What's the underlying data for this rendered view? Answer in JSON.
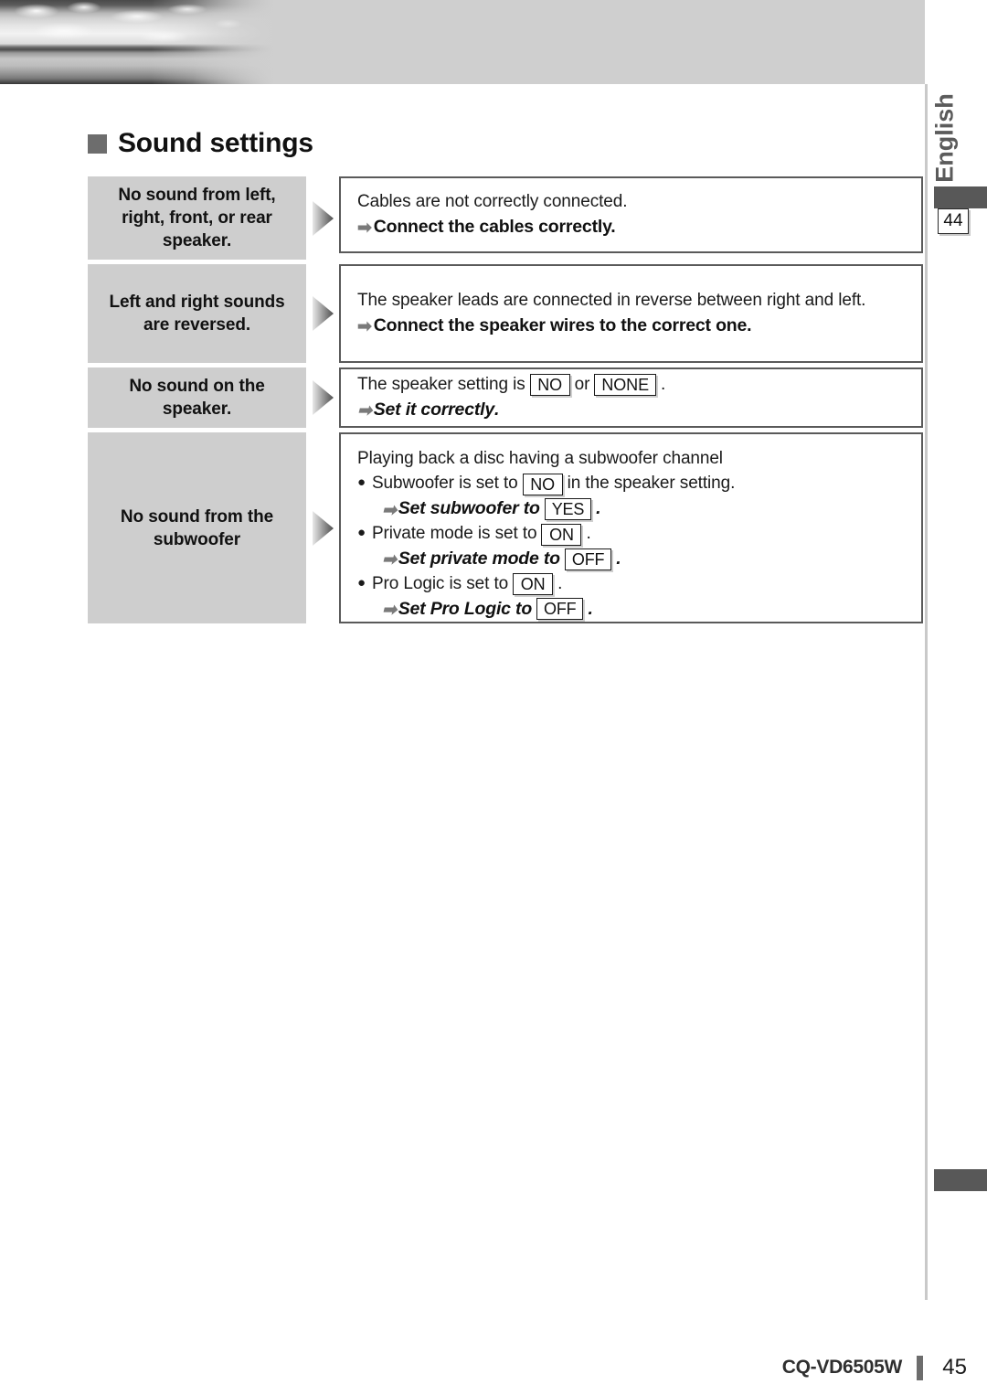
{
  "document": {
    "language_tab": "English",
    "page_reference_badge": "44",
    "section_heading": "Sound settings",
    "footer": {
      "model": "CQ-VD6505W",
      "page_number": "45"
    },
    "colors": {
      "symptom_cell_bg": "#cecece",
      "banner_bg": "#cfcfcf",
      "heading_square": "#6d6d6d",
      "detail_border": "#5a5a5a",
      "side_mark": "#585858",
      "arrow_glyph": "#7a7a7a"
    }
  },
  "icons": {
    "heading_square": "filled-square",
    "flow_arrow": "triangle-right",
    "action_arrow": "➡",
    "bullet": "●"
  },
  "rows": [
    {
      "symptom": "No sound from left, right, front, or rear speaker.",
      "cause": "Cables are not correctly connected.",
      "action": "Connect the cables correctly."
    },
    {
      "symptom": "Left and right sounds are reversed.",
      "cause": "The speaker leads are connected in reverse between right and left.",
      "action": "Connect the speaker wires to the correct one."
    },
    {
      "symptom": "No sound on the speaker.",
      "cause_pre": "The speaker setting is",
      "cause_value_1": "NO",
      "cause_mid": "or",
      "cause_value_2": "NONE",
      "cause_post": ".",
      "action": "Set it correctly",
      "action_post": "."
    },
    {
      "symptom": "No sound from the subwoofer",
      "intro": "Playing back a disc having a subwoofer channel",
      "items": [
        {
          "cause_pre": "Subwoofer is set to",
          "cause_value": "NO",
          "cause_post": "in the speaker setting.",
          "action_pre": "Set subwoofer to",
          "action_value": "YES",
          "action_post": "."
        },
        {
          "cause_pre": "Private mode is set to",
          "cause_value": "ON",
          "cause_post": ".",
          "action_pre": "Set private mode to",
          "action_value": "OFF",
          "action_post": "."
        },
        {
          "cause_pre": "Pro Logic is set to",
          "cause_value": "ON",
          "cause_post": ".",
          "action_pre": "Set Pro Logic to",
          "action_value": "OFF",
          "action_post": "."
        }
      ]
    }
  ]
}
